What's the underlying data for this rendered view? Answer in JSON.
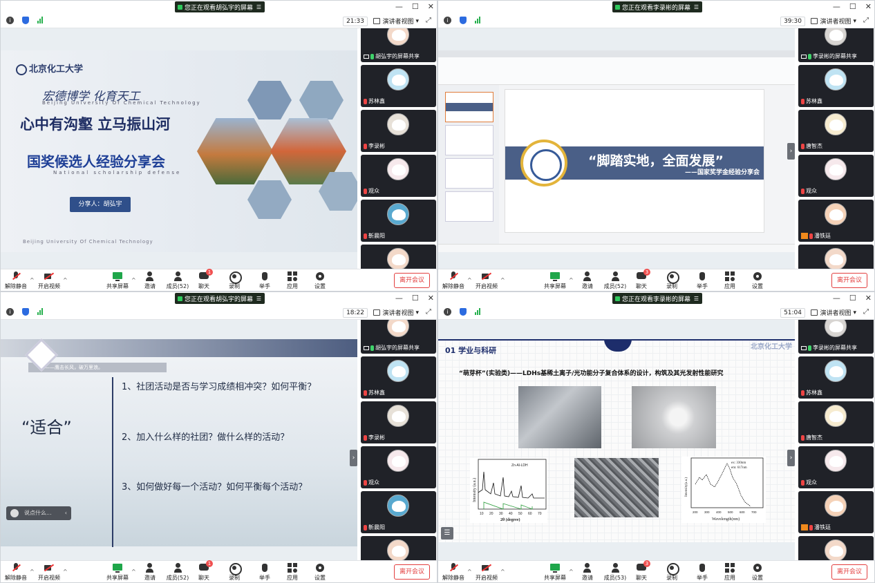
{
  "quads": [
    {
      "share_banner": "您正在观看胡弘宇的屏幕",
      "timer": "21:33",
      "view_mode": "演讲者视图",
      "participants": [
        {
          "name": "胡弘宇的屏幕共享",
          "status": "share"
        },
        {
          "name": "苏林鑫",
          "status": "muted"
        },
        {
          "name": "李录彬",
          "status": "muted"
        },
        {
          "name": "观众",
          "status": "muted"
        },
        {
          "name": "靳晨阳",
          "status": "muted"
        },
        {
          "name": "",
          "status": "muted"
        }
      ],
      "toolbar": {
        "mute": "解除静音",
        "video": "开启视频",
        "share": "共享屏幕",
        "invite": "邀请",
        "members": "成员(52)",
        "chat": "聊天",
        "chat_badge": "1",
        "record": "录制",
        "raise_hand": "举手",
        "apps": "应用",
        "settings": "设置",
        "leave": "离开会议"
      }
    },
    {
      "share_banner": "您正在观看李录彬的屏幕",
      "timer": "39:30",
      "view_mode": "演讲者视图",
      "participants": [
        {
          "name": "李录彬的屏幕共享",
          "status": "share"
        },
        {
          "name": "苏林鑫",
          "status": "muted"
        },
        {
          "name": "唐智杰",
          "status": "muted"
        },
        {
          "name": "观众",
          "status": "muted"
        },
        {
          "name": "潘铁廷",
          "status": "host"
        },
        {
          "name": "",
          "status": "muted"
        }
      ],
      "toolbar": {
        "mute": "解除静音",
        "video": "开启视频",
        "share": "共享屏幕",
        "invite": "邀请",
        "members": "成员(52)",
        "chat": "聊天",
        "chat_badge": "3",
        "record": "录制",
        "raise_hand": "举手",
        "apps": "应用",
        "settings": "设置",
        "leave": "离开会议"
      }
    },
    {
      "share_banner": "您正在观看胡弘宇的屏幕",
      "timer": "18:22",
      "view_mode": "演讲者视图",
      "participants": [
        {
          "name": "胡弘宇的屏幕共享",
          "status": "share"
        },
        {
          "name": "苏林鑫",
          "status": "muted"
        },
        {
          "name": "李录彬",
          "status": "muted"
        },
        {
          "name": "观众",
          "status": "muted"
        },
        {
          "name": "靳晨阳",
          "status": "muted"
        },
        {
          "name": "",
          "status": "muted"
        }
      ],
      "toolbar": {
        "mute": "解除静音",
        "video": "开启视频",
        "share": "共享屏幕",
        "invite": "邀请",
        "members": "成员(52)",
        "chat": "聊天",
        "chat_badge": "1",
        "record": "录制",
        "raise_hand": "举手",
        "apps": "应用",
        "settings": "设置",
        "leave": "离开会议"
      }
    },
    {
      "share_banner": "您正在观看李录彬的屏幕",
      "timer": "51:04",
      "view_mode": "演讲者视图",
      "participants": [
        {
          "name": "李录彬的屏幕共享",
          "status": "share"
        },
        {
          "name": "苏林鑫",
          "status": "muted"
        },
        {
          "name": "唐智杰",
          "status": "muted"
        },
        {
          "name": "观众",
          "status": "muted"
        },
        {
          "name": "潘铁廷",
          "status": "host"
        },
        {
          "name": "",
          "status": "muted"
        }
      ],
      "toolbar": {
        "mute": "解除静音",
        "video": "开启视频",
        "share": "共享屏幕",
        "invite": "邀请",
        "members": "成员(53)",
        "chat": "聊天",
        "chat_badge": "3",
        "record": "录制",
        "raise_hand": "举手",
        "apps": "应用",
        "settings": "设置",
        "leave": "离开会议"
      }
    }
  ],
  "slide1": {
    "school": "北京化工大学",
    "motto": "宏德博学  化育天工",
    "motto_en": "Beijing University Of Chemical Technology",
    "headline": "心中有沟壑  立马振山河",
    "subtitle": "国奖候选人经验分享会",
    "subtitle_en": "National scholarship defense",
    "presenter": "分享人：胡弘宇",
    "footer": "Beijing University Of Chemical Technology"
  },
  "slide2": {
    "title": "“脚踏实地，全面发展”",
    "subtitle": "——国家奖学金经验分享会"
  },
  "slide3": {
    "strip": "——鹰击长风，破万里浪。",
    "keyword": "“适合”",
    "questions": [
      "1、社团活动是否与学习成绩相冲突？如何平衡？",
      "2、加入什么样的社团？做什么样的活动？",
      "3、如何做好每一个活动？如何平衡每个活动？"
    ],
    "danmu_placeholder": "说点什么..."
  },
  "slide4": {
    "section": "01 学业与科研",
    "brand": "北京化工大学",
    "title": "“萌芽杯”(实验类)——LDHs基稀土离子/光功能分子复合体系的设计，构筑及其光发射性能研究",
    "xrd": {
      "xlabel": "2θ (degree)",
      "ylabel": "Intensity (a.u.)",
      "legend": "Zn-Al-LDH",
      "ticks": [
        "10",
        "20",
        "30",
        "40",
        "50",
        "60",
        "70"
      ]
    },
    "pl": {
      "xlabel": "Wavelength(nm)",
      "ylabel": "Intensity(a.u.)",
      "ex": "ex: 330nm",
      "em": "em: 617nm",
      "ticks": [
        "200",
        "300",
        "400",
        "500",
        "600",
        "700"
      ]
    }
  },
  "colors": {
    "accent": "#1fa64a",
    "leave": "#e23d3d",
    "navy": "#1e2d63"
  }
}
